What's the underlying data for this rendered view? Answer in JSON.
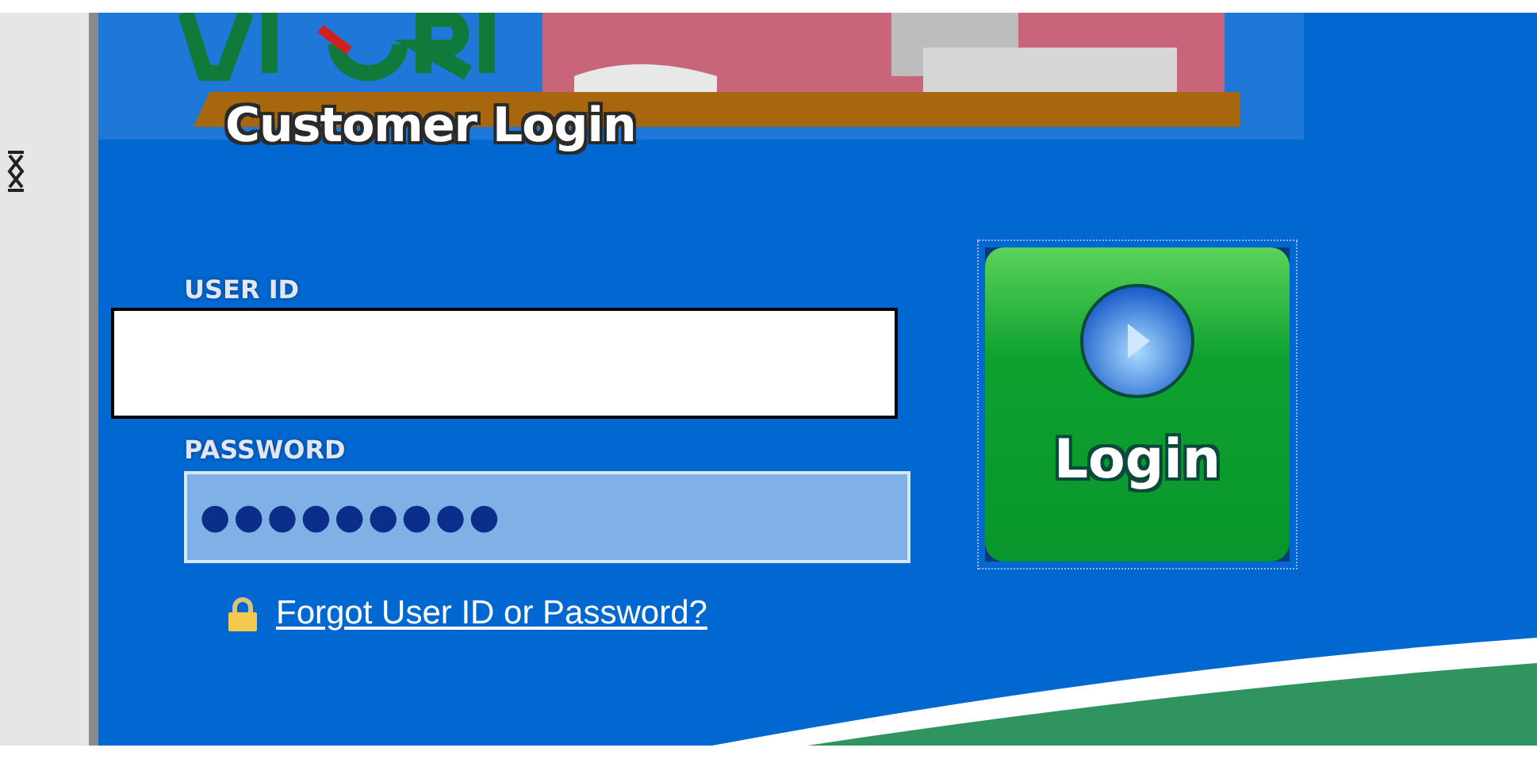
{
  "header": {
    "title": "Customer Login"
  },
  "fields": [
    {
      "label": "USER ID",
      "kind": "redacted"
    },
    {
      "label": "PASSWORD",
      "kind": "password",
      "value": "●●●●●●●●●"
    }
  ],
  "forgot_link": "Forgot User ID or Password?",
  "login_button": "Login"
}
